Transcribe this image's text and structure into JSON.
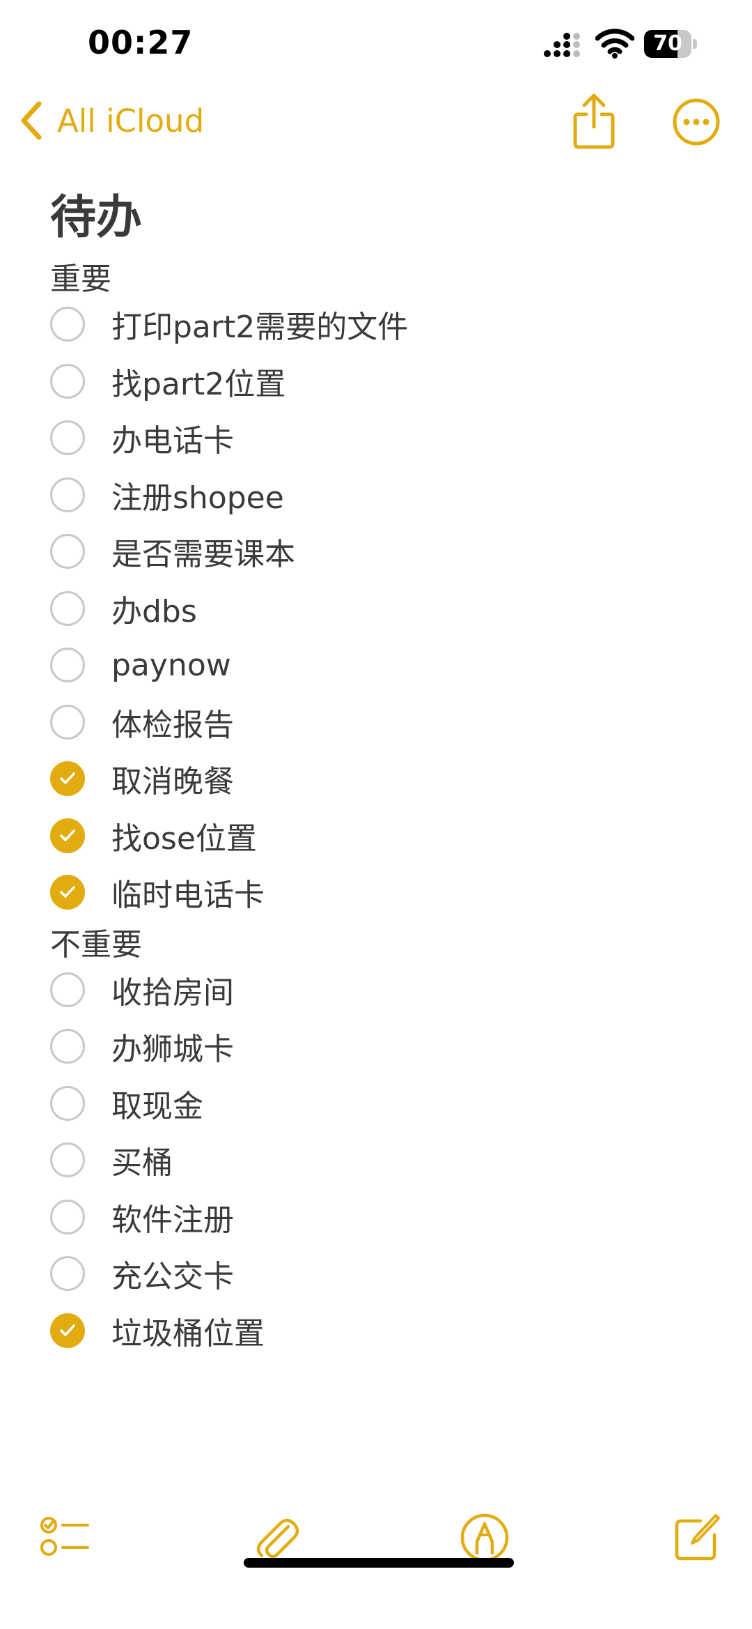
{
  "status_bar": {
    "time": "00:27",
    "battery_level": "70",
    "battery_fraction": 0.7
  },
  "nav": {
    "back_label": "All iCloud",
    "accent_color": "#e2ac10"
  },
  "note": {
    "title": "待办",
    "sections": [
      {
        "heading": "重要",
        "items": [
          {
            "label": "打印part2需要的文件",
            "checked": false
          },
          {
            "label": "找part2位置",
            "checked": false
          },
          {
            "label": "办电话卡",
            "checked": false
          },
          {
            "label": "注册shopee",
            "checked": false
          },
          {
            "label": "是否需要课本",
            "checked": false
          },
          {
            "label": "办dbs",
            "checked": false
          },
          {
            "label": "paynow",
            "checked": false
          },
          {
            "label": "体检报告",
            "checked": false
          },
          {
            "label": "取消晚餐",
            "checked": true
          },
          {
            "label": "找ose位置",
            "checked": true
          },
          {
            "label": "临时电话卡",
            "checked": true
          }
        ]
      },
      {
        "heading": "不重要",
        "items": [
          {
            "label": "收拾房间",
            "checked": false
          },
          {
            "label": "办狮城卡",
            "checked": false
          },
          {
            "label": "取现金",
            "checked": false
          },
          {
            "label": "买桶",
            "checked": false
          },
          {
            "label": "软件注册",
            "checked": false
          },
          {
            "label": "充公交卡",
            "checked": false
          },
          {
            "label": "垃圾桶位置",
            "checked": true
          }
        ]
      }
    ]
  },
  "toolbar": {
    "items": [
      "checklist-icon",
      "paperclip-icon",
      "markup-pen-icon",
      "compose-icon"
    ]
  }
}
